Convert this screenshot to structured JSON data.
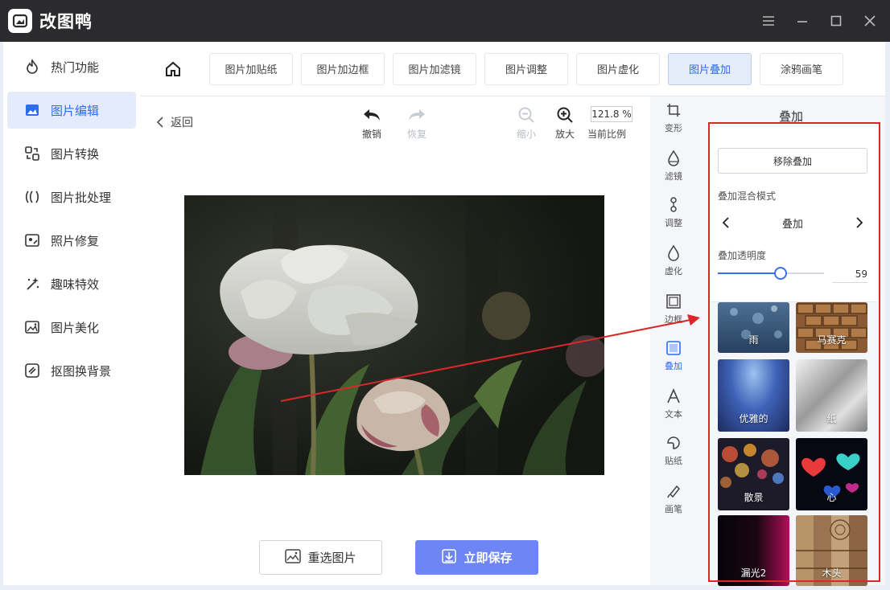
{
  "app": {
    "title": "改图鸭"
  },
  "sidebar": {
    "items": [
      {
        "label": "热门功能",
        "icon": "fire-icon"
      },
      {
        "label": "图片编辑",
        "icon": "image-edit-icon",
        "active": true
      },
      {
        "label": "图片转换",
        "icon": "convert-icon"
      },
      {
        "label": "图片批处理",
        "icon": "batch-icon"
      },
      {
        "label": "照片修复",
        "icon": "repair-icon"
      },
      {
        "label": "趣味特效",
        "icon": "effects-icon"
      },
      {
        "label": "图片美化",
        "icon": "beautify-icon"
      },
      {
        "label": "抠图换背景",
        "icon": "cutout-icon"
      }
    ]
  },
  "tabs": {
    "items": [
      {
        "label": "图片加贴纸"
      },
      {
        "label": "图片加边框"
      },
      {
        "label": "图片加滤镜"
      },
      {
        "label": "图片调整"
      },
      {
        "label": "图片虚化"
      },
      {
        "label": "图片叠加",
        "active": true
      },
      {
        "label": "涂鸦画笔"
      }
    ]
  },
  "toolbar": {
    "back": "返回",
    "undo": "撤销",
    "redo": "恢复",
    "zoom_out": "缩小",
    "zoom_in": "放大",
    "zoom_value": "121.8 %",
    "zoom_label": "当前比例"
  },
  "actions": {
    "reselect": "重选图片",
    "save": "立即保存"
  },
  "vtools": {
    "items": [
      {
        "label": "变形",
        "icon": "crop-icon"
      },
      {
        "label": "滤镜",
        "icon": "filter-drop-icon"
      },
      {
        "label": "调整",
        "icon": "adjust-icon"
      },
      {
        "label": "虚化",
        "icon": "blur-drop-icon"
      },
      {
        "label": "边框",
        "icon": "frame-icon"
      },
      {
        "label": "叠加",
        "icon": "overlay-icon",
        "active": true
      },
      {
        "label": "文本",
        "icon": "text-icon"
      },
      {
        "label": "贴纸",
        "icon": "sticker-icon"
      },
      {
        "label": "画笔",
        "icon": "brush-icon"
      }
    ]
  },
  "panel": {
    "title": "叠加",
    "remove": "移除叠加",
    "blend_label": "叠加混合模式",
    "blend_value": "叠加",
    "opacity_label": "叠加透明度",
    "opacity_value": "59",
    "opacity_fraction": 0.59
  },
  "thumbs": {
    "items": [
      {
        "label": "雨"
      },
      {
        "label": "马赛克"
      },
      {
        "label": "优雅的"
      },
      {
        "label": "纸"
      },
      {
        "label": "散景"
      },
      {
        "label": "心"
      },
      {
        "label": "漏光2"
      },
      {
        "label": "木头"
      }
    ]
  },
  "colors": {
    "accent": "#2b6df0",
    "save_button": "#6e86f5",
    "highlight_box": "#d9282a",
    "titlebar": "#2b2b2e"
  }
}
